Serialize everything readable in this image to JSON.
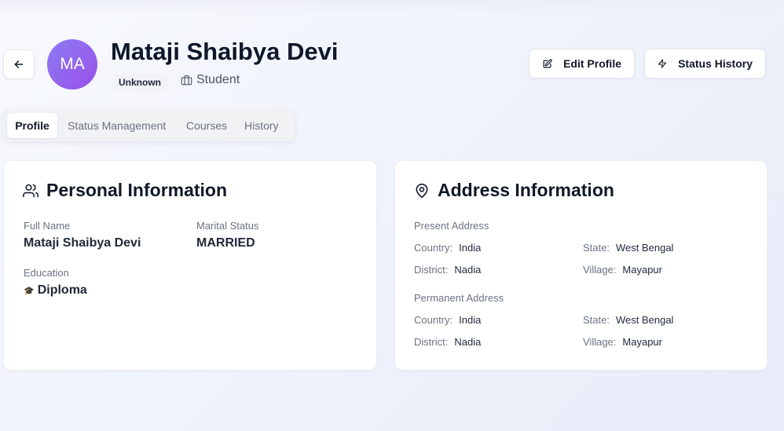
{
  "header": {
    "avatar_initials": "MA",
    "name": "Mataji Shaibya Devi",
    "badge": "Unknown",
    "role": "Student",
    "edit_button": "Edit Profile",
    "status_history_button": "Status History"
  },
  "tabs": [
    "Profile",
    "Status Management",
    "Courses",
    "History"
  ],
  "personal": {
    "title": "Personal Information",
    "full_name_label": "Full Name",
    "full_name": "Mataji Shaibya Devi",
    "marital_status_label": "Marital Status",
    "marital_status": "MARRIED",
    "education_label": "Education",
    "education_icon": "🎓",
    "education": "Diploma"
  },
  "address": {
    "title": "Address Information",
    "present": {
      "heading": "Present Address",
      "country_label": "Country:",
      "country": "India",
      "state_label": "State:",
      "state": "West Bengal",
      "district_label": "District:",
      "district": "Nadia",
      "village_label": "Village:",
      "village": "Mayapur"
    },
    "permanent": {
      "heading": "Permanent Address",
      "country_label": "Country:",
      "country": "India",
      "state_label": "State:",
      "state": "West Bengal",
      "district_label": "District:",
      "district": "Nadia",
      "village_label": "Village:",
      "village": "Mayapur"
    }
  },
  "icons": {
    "back": "arrow-left-icon",
    "role": "briefcase-icon",
    "edit": "edit-icon",
    "status": "lightning-icon",
    "personal": "users-icon",
    "address": "map-pin-icon"
  },
  "colors": {
    "avatar_start": "#8b7cf6",
    "avatar_end": "#9a4fe6"
  }
}
